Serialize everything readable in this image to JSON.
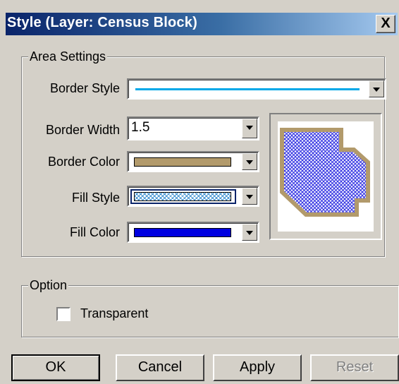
{
  "window": {
    "title": "Style (Layer: Census Block)",
    "close_glyph": "X"
  },
  "area_settings": {
    "legend": "Area Settings",
    "border_style": {
      "label": "Border Style",
      "line_color": "#00a8e8"
    },
    "border_width": {
      "label": "Border Width",
      "value": "1.5"
    },
    "border_color": {
      "label": "Border Color",
      "color": "#b29a6b"
    },
    "fill_style": {
      "label": "Fill Style",
      "pattern": "crosshatch",
      "pattern_color": "#0000ff"
    },
    "fill_color": {
      "label": "Fill Color",
      "color": "#0000e0"
    }
  },
  "preview": {
    "border_color": "#b29a6b",
    "fill_color": "#2a2ae0",
    "pattern": "crosshatch"
  },
  "option": {
    "legend": "Option",
    "transparent": {
      "label": "Transparent",
      "checked": false
    }
  },
  "buttons": {
    "ok": "OK",
    "cancel": "Cancel",
    "apply": "Apply",
    "reset": "Reset"
  },
  "icons": {
    "dropdown": "chevron-down-icon"
  }
}
